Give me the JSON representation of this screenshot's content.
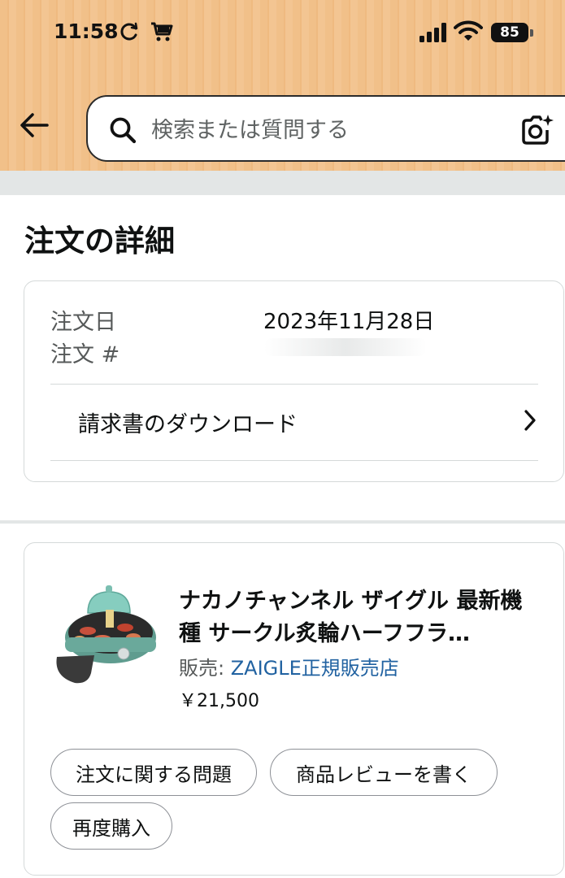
{
  "status_bar": {
    "time": "11:58",
    "battery": "85",
    "icons": [
      "sync-icon",
      "cart-icon",
      "signal-icon",
      "wifi-icon",
      "battery-icon"
    ]
  },
  "search": {
    "placeholder": "検索または質問する",
    "value": "",
    "icons": [
      "back-arrow-icon",
      "search-icon",
      "camera-icon"
    ]
  },
  "page": {
    "title": "注文の詳細"
  },
  "order_info": {
    "date_label": "注文日",
    "date_value": "2023年11月28日",
    "number_label": "注文 #",
    "invoice_label": "請求書のダウンロード"
  },
  "product": {
    "title": "ナカノチャンネル ザイグル 最新機種 サークル炙輪ハーフフラ…",
    "seller_prefix": "販売: ",
    "seller_name": "ZAIGLE正規販売店",
    "price": "￥21,500"
  },
  "actions": {
    "problem": "注文に関する問題",
    "review": "商品レビューを書く",
    "rebuy": "再度購入"
  },
  "colors": {
    "header_bg": "#f1c089",
    "link": "#2162a1",
    "border": "#d5d9d9",
    "band": "#e3e6e6"
  }
}
